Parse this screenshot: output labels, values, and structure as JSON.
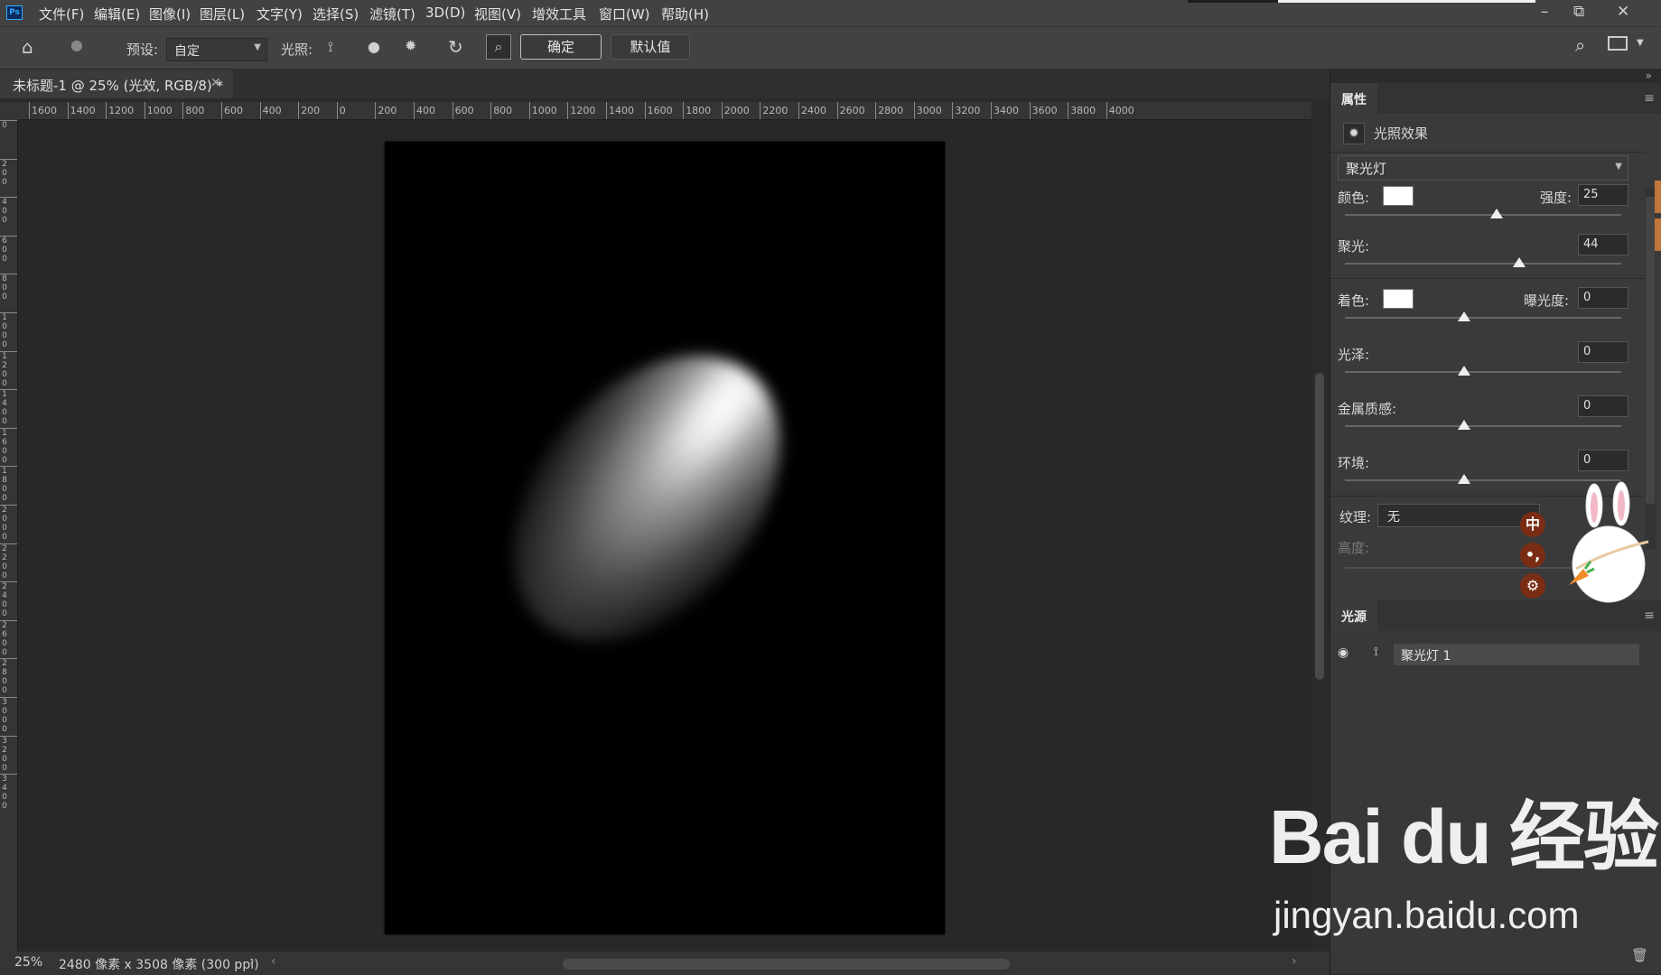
{
  "app": {
    "logo": "Ps",
    "menus": [
      "文件(F)",
      "编辑(E)",
      "图像(I)",
      "图层(L)",
      "文字(Y)",
      "选择(S)",
      "滤镜(T)",
      "3D(D)",
      "视图(V)",
      "增效工具",
      "窗口(W)",
      "帮助(H)"
    ],
    "window_controls": [
      "–",
      "⧉",
      "✕"
    ]
  },
  "options": {
    "preset_label": "预设:",
    "preset_value": "自定",
    "lights_label": "光照:",
    "ok_label": "确定",
    "default_label": "默认值"
  },
  "document": {
    "tab_title": "未标题-1 @ 25% (光效, RGB/8) *",
    "h_ruler": [
      "1600",
      "1400",
      "1200",
      "1000",
      "800",
      "600",
      "400",
      "200",
      "0",
      "200",
      "400",
      "600",
      "800",
      "1000",
      "1200",
      "1400",
      "1600",
      "1800",
      "2000",
      "2200",
      "2400",
      "2600",
      "2800",
      "3000",
      "3200",
      "3400",
      "3600",
      "3800",
      "4000"
    ],
    "v_ruler": [
      "0",
      "200",
      "400",
      "600",
      "800",
      "1000",
      "1200",
      "1400",
      "1600",
      "1800",
      "2000",
      "2200",
      "2400",
      "2600",
      "2800",
      "3000",
      "3200",
      "3400"
    ]
  },
  "status": {
    "zoom": "25%",
    "doc_info": "2480 像素 x 3508 像素 (300 ppi)"
  },
  "properties": {
    "panel_title": "属性",
    "effect_name": "光照效果",
    "light_type": "聚光灯",
    "color_label": "颜色:",
    "intensity_label": "强度:",
    "intensity_value": "25",
    "intensity_pos": 0.55,
    "hotspot_label": "聚光:",
    "hotspot_value": "44",
    "hotspot_pos": 0.63,
    "colorize_label": "着色:",
    "exposure_label": "曝光度:",
    "exposure_value": "0",
    "exposure_pos": 0.43,
    "gloss_label": "光泽:",
    "gloss_value": "0",
    "gloss_pos": 0.43,
    "metallic_label": "金属质感:",
    "metallic_value": "0",
    "metallic_pos": 0.43,
    "ambience_label": "环境:",
    "ambience_value": "0",
    "ambience_pos": 0.43,
    "texture_label": "纹理:",
    "texture_value": "无",
    "height_label": "高度:"
  },
  "lights": {
    "panel_title": "光源",
    "items": [
      {
        "label": "聚光灯 1"
      }
    ]
  },
  "overlay": {
    "ime_buttons": [
      "中",
      "•,",
      "⚙"
    ],
    "watermark": "Bai du 经验",
    "watermark_url": "jingyan.baidu.com"
  }
}
